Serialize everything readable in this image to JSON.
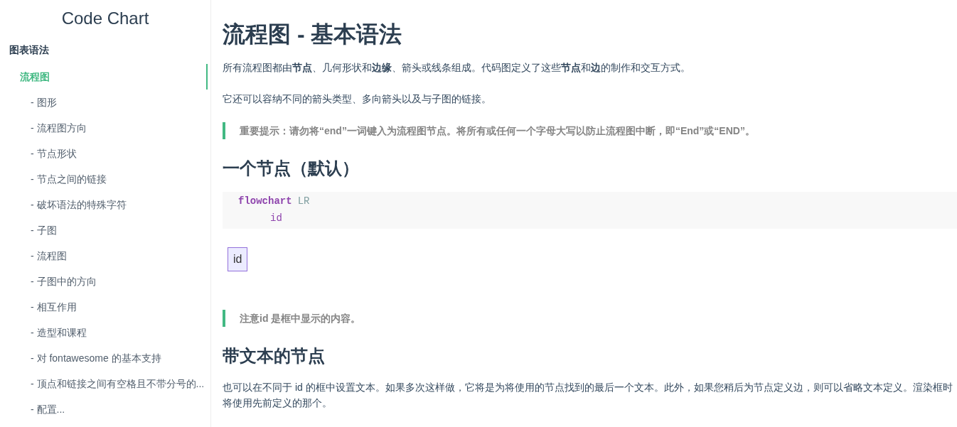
{
  "sidebar": {
    "title": "Code Chart",
    "section": "图表语法",
    "items": [
      {
        "label": "流程图",
        "selected": true,
        "children": [
          {
            "label": "- 图形",
            "selected": false
          },
          {
            "label": "- 流程图方向",
            "selected": false
          },
          {
            "label": "- 节点形状",
            "selected": false
          },
          {
            "label": "- 节点之间的链接",
            "selected": false
          },
          {
            "label": "- 破坏语法的特殊字符",
            "selected": false
          },
          {
            "label": "- 子图",
            "selected": false
          },
          {
            "label": "- 流程图",
            "selected": false
          },
          {
            "label": "- 子图中的方向",
            "selected": false
          },
          {
            "label": "- 相互作用",
            "selected": false
          },
          {
            "label": "- 造型和课程",
            "selected": false
          },
          {
            "label": "- 对 fontawesome 的基本支持",
            "selected": false
          },
          {
            "label": "- 顶点和链接之间有空格且不带分号的...",
            "selected": false
          },
          {
            "label": "- 配置...",
            "selected": false
          }
        ]
      }
    ]
  },
  "content": [
    {
      "kind": "h1",
      "text": "流程图 - 基本语法"
    },
    {
      "kind": "p",
      "text": "所有流程图都由**节点**、几何形状和**边缘**、箭头或线条组成。代码图定义了这些**节点**和**边**的制作和交互方式。"
    },
    {
      "kind": "p",
      "text": "它还可以容纳不同的箭头类型、多向箭头以及与子图的链接。"
    },
    {
      "kind": "note",
      "text": "**重要提示：**请勿将“end”一词键入为流程图节点。将所有或任何一个字母大写以防止流程图中断，即“End”或“END”。"
    },
    {
      "kind": "h2",
      "text": "一个节点（默认）"
    },
    {
      "kind": "code",
      "lines": [
        {
          "indented": false,
          "tokens": [
            {
              "kind": "keyword",
              "text": "flowchart"
            },
            {
              "kind": "plain",
              "text": "LR"
            }
          ]
        },
        {
          "indented": true,
          "tokens": [
            {
              "kind": "id",
              "text": "id"
            }
          ]
        }
      ]
    },
    {
      "kind": "node",
      "text": "id"
    },
    {
      "kind": "note",
      "text": "**注意**id 是框中显示的内容。"
    },
    {
      "kind": "h2",
      "text": "带文本的节点"
    },
    {
      "kind": "p",
      "text": "也可以在不同于 id 的框中设置文本。如果多次这样做，它将是为将使用的节点找到的最后一个文本。此外，如果您稍后为节点定义边，则可以省略文本定义。渲染框时将使用先前定义的那个。"
    }
  ]
}
